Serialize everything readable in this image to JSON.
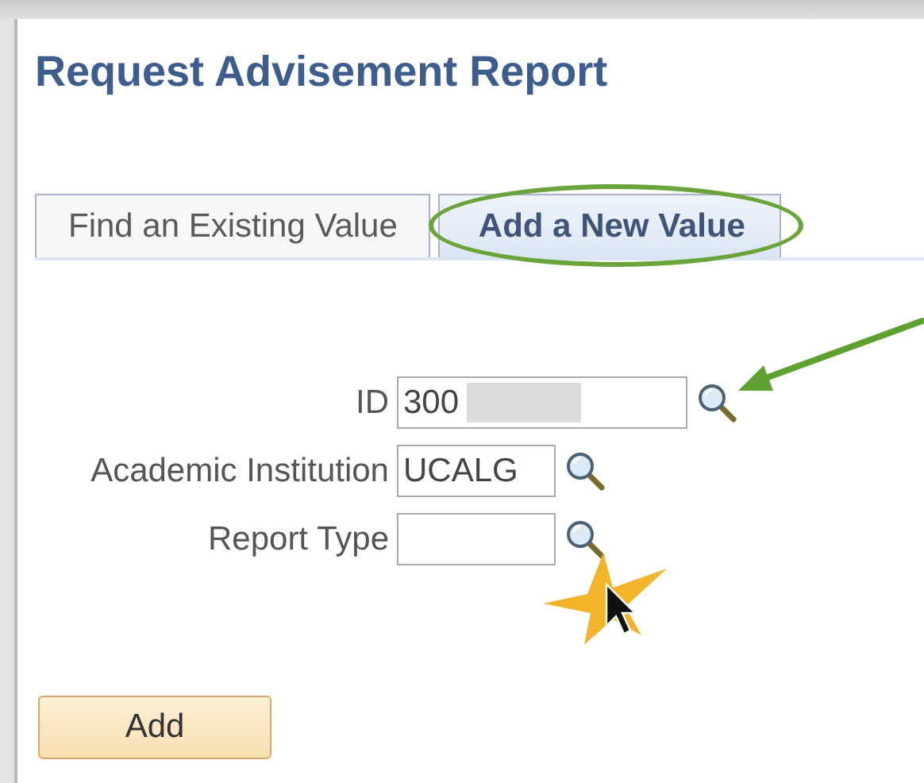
{
  "page": {
    "title": "Request Advisement Report"
  },
  "tabs": [
    {
      "label": "Find an Existing Value",
      "selected": false,
      "circled": false
    },
    {
      "label": "Add a New Value",
      "selected": true,
      "circled": true
    }
  ],
  "fields": [
    {
      "label": "ID",
      "value": "300",
      "redacted": true,
      "pointed": true,
      "clicked": false
    },
    {
      "label": "Academic Institution",
      "value": "UCALG",
      "redacted": false,
      "pointed": false,
      "clicked": false
    },
    {
      "label": "Report Type",
      "redacted": false,
      "pointed": false,
      "clicked": true
    }
  ],
  "buttons": [
    "Add"
  ]
}
